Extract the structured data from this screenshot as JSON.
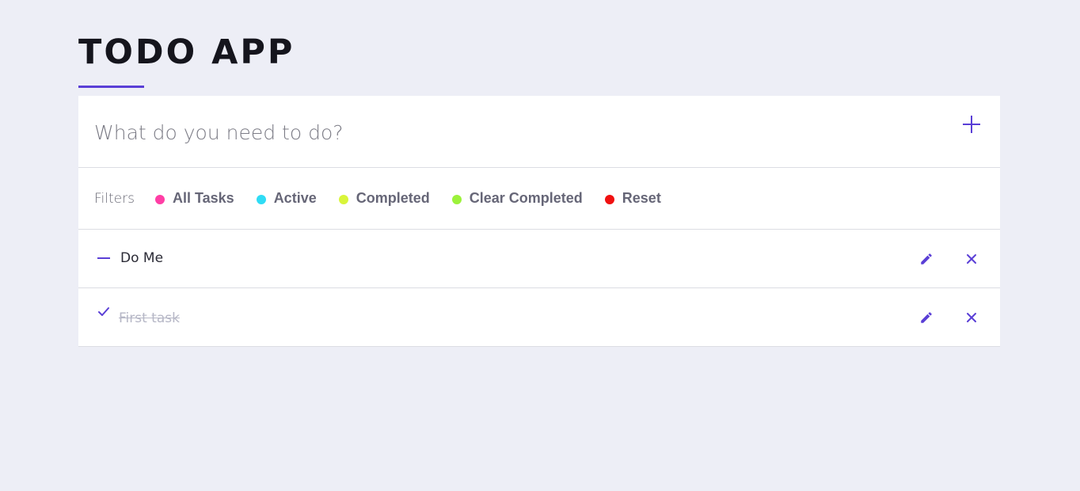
{
  "header": {
    "title": "TODO APP"
  },
  "new_task": {
    "placeholder": "What do you need to do?",
    "value": "",
    "add_icon": "plus-icon"
  },
  "filters": {
    "label": "Filters",
    "items": [
      {
        "label": "All Tasks",
        "color": "#ff3ea5"
      },
      {
        "label": "Active",
        "color": "#2fdcf5"
      },
      {
        "label": "Completed",
        "color": "#d9f53a"
      },
      {
        "label": "Clear Completed",
        "color": "#9cf23a"
      },
      {
        "label": "Reset",
        "color": "#f01010"
      }
    ]
  },
  "tasks": [
    {
      "text": "Do Me",
      "completed": false,
      "status_icon": "minus-icon"
    },
    {
      "text": "First task",
      "completed": true,
      "status_icon": "check-icon"
    }
  ],
  "colors": {
    "accent": "#5a3fd6",
    "background": "#edeef6"
  }
}
